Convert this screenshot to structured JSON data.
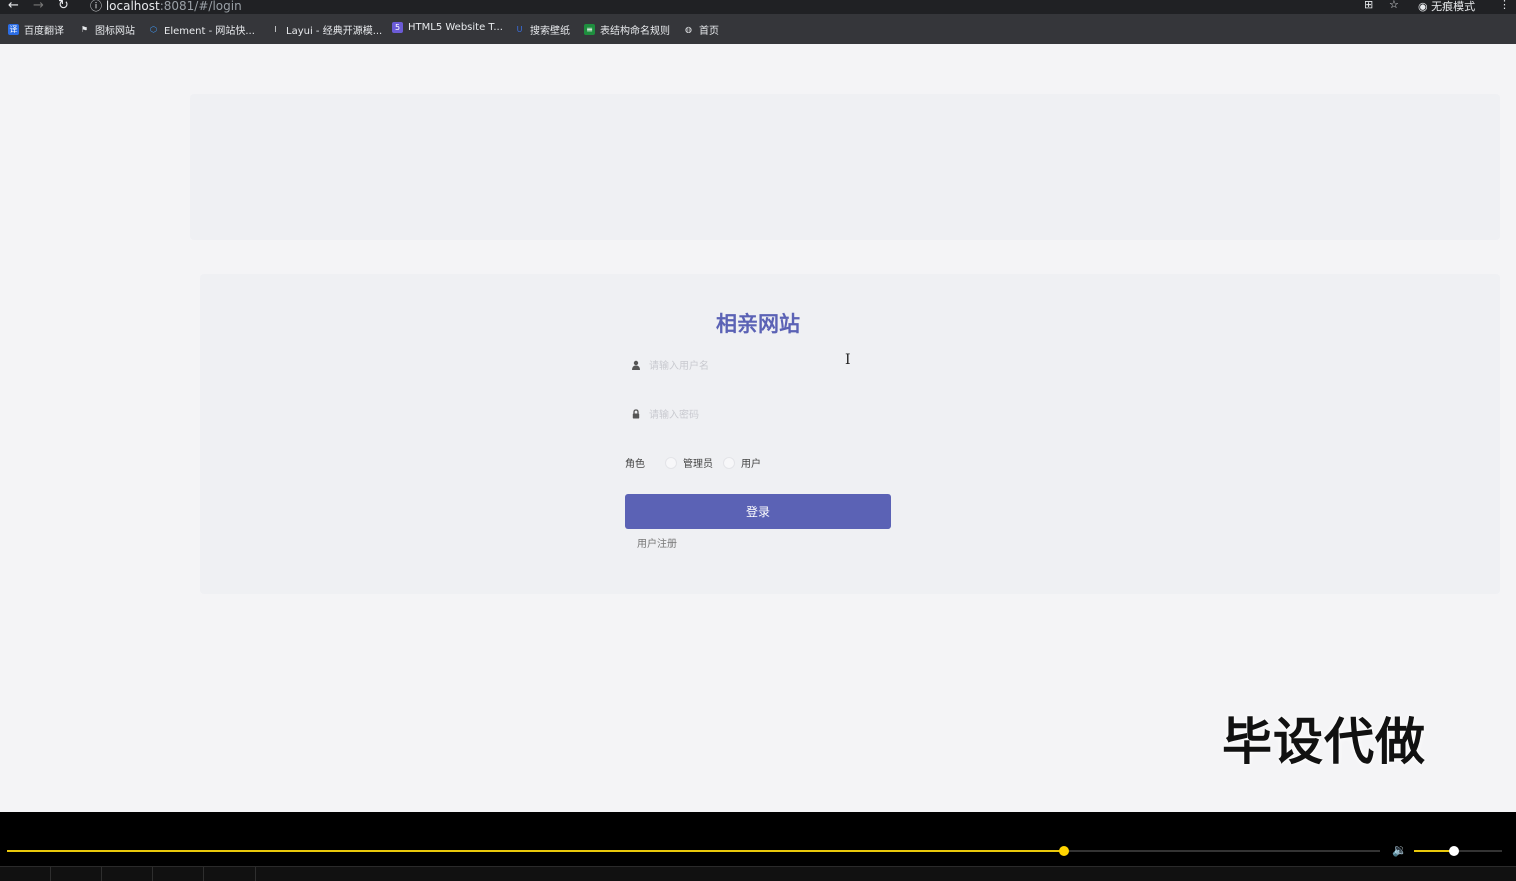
{
  "browser": {
    "url_host": "localhost",
    "url_rest": ":8081/#/login",
    "incognito_label": "无痕模式",
    "bookmarks": [
      {
        "label": "百度翻译",
        "icon": "translate-icon",
        "color": "#2b6de5"
      },
      {
        "label": "图标网站",
        "icon": "flag-icon",
        "color": "#e8eaed"
      },
      {
        "label": "Element - 网站快...",
        "icon": "element-icon",
        "color": "#409eff"
      },
      {
        "label": "Layui - 经典开源模...",
        "icon": "layui-icon",
        "color": "#e8eaed"
      },
      {
        "label": "HTML5 Website T...",
        "icon": "html5-icon",
        "color": "#6b5bd6"
      },
      {
        "label": "搜索壁纸",
        "icon": "wallpaper-icon",
        "color": "#3a6fe0"
      },
      {
        "label": "表结构命名规则",
        "icon": "sheet-icon",
        "color": "#1e8e3e"
      },
      {
        "label": "首页",
        "icon": "globe-icon",
        "color": "#e8eaed"
      }
    ]
  },
  "login": {
    "title": "相亲网站",
    "username_placeholder": "请输入用户名",
    "password_placeholder": "请输入密码",
    "role_label": "角色",
    "role_options": [
      "管理员",
      "用户"
    ],
    "submit_label": "登录",
    "register_link": "用户注册",
    "accent_color": "#5b62b5"
  },
  "watermark": "毕设代做",
  "player": {
    "progress_fraction": 0.77,
    "volume_fraction": 0.45
  }
}
